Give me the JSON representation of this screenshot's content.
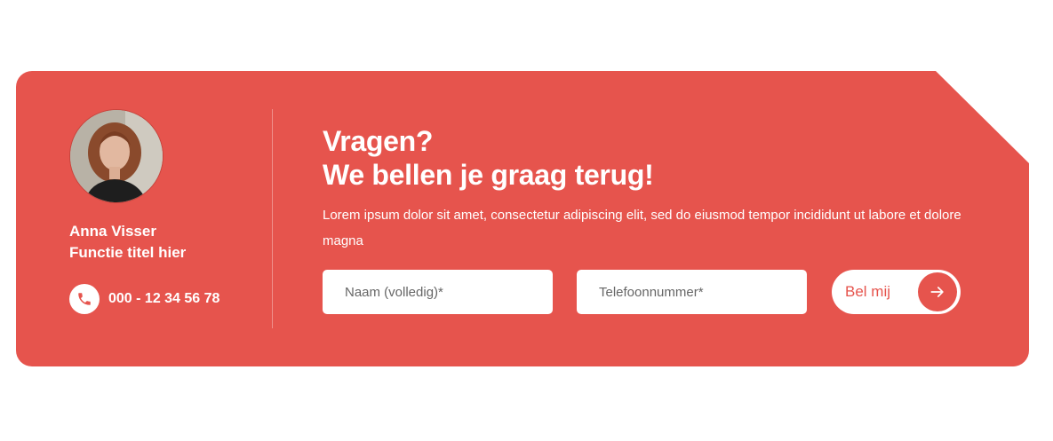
{
  "contact": {
    "name": "Anna Visser",
    "role": "Functie titel hier",
    "phone": "000 - 12 34 56 78",
    "phone_icon": "phone-icon",
    "avatar": "portrait-photo"
  },
  "main": {
    "heading_line1": "Vragen?",
    "heading_line2": "We bellen je graag terug!",
    "intro": "Lorem ipsum dolor sit amet, consectetur adipiscing elit, sed do eiusmod tempor incididunt ut labore et dolore magna"
  },
  "form": {
    "name_placeholder": "Naam (volledig)*",
    "phone_placeholder": "Telefoonnummer*",
    "submit_label": "Bel mij",
    "submit_icon": "arrow-right-icon"
  },
  "colors": {
    "brand": "#e6544d",
    "text_on_brand": "#ffffff"
  }
}
